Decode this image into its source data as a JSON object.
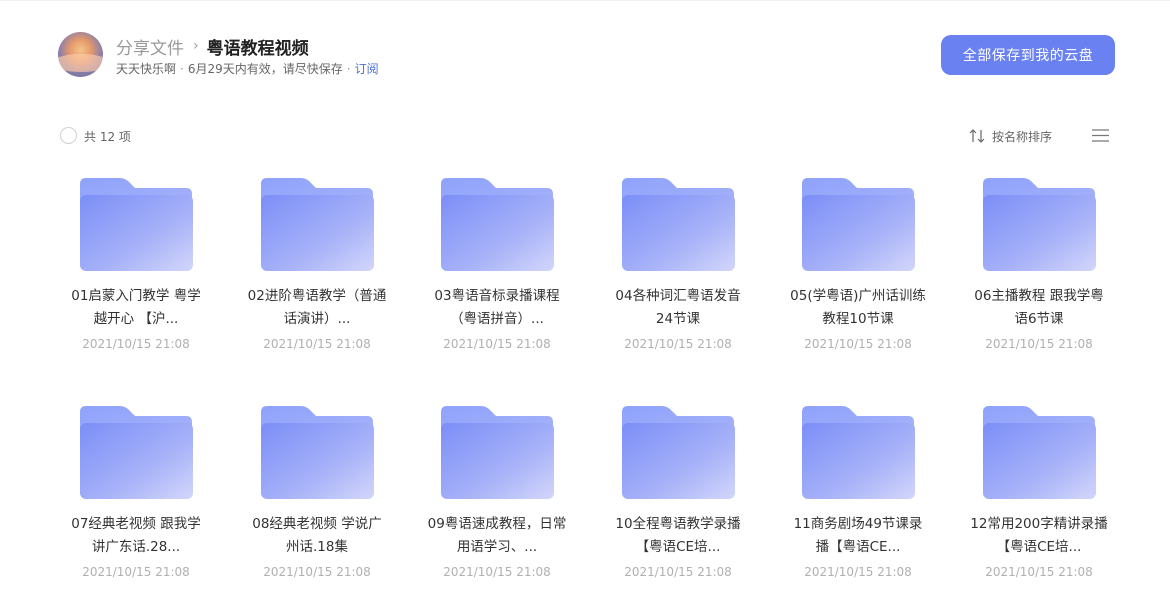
{
  "header": {
    "breadcrumb_root": "分享文件",
    "breadcrumb_sep": "›",
    "title": "粤语教程视频",
    "owner": "天天快乐啊",
    "meta_dot": "·",
    "expiry": "6月29天内有效，请尽快保存",
    "subscribe_label": "订阅"
  },
  "actions": {
    "save_all_label": "全部保存到我的云盘"
  },
  "toolbar": {
    "count_label": "共 12 项",
    "sort_label": "按名称排序"
  },
  "colors": {
    "accent": "#6a81f2",
    "link": "#4a72d8",
    "folder_light": "#b9c3fb",
    "folder_dark": "#7b8cf6"
  },
  "icons": {
    "sort": "sort-arrows-icon",
    "list": "list-view-icon",
    "folder": "folder-icon"
  },
  "files": [
    {
      "name": "01启蒙入门教学 粤学越开心 【沪...",
      "date": "2021/10/15 21:08"
    },
    {
      "name": "02进阶粤语教学（普通话演讲）...",
      "date": "2021/10/15 21:08"
    },
    {
      "name": "03粤语音标录播课程（粤语拼音）...",
      "date": "2021/10/15 21:08"
    },
    {
      "name": "04各种词汇粤语发音 24节课",
      "date": "2021/10/15 21:08"
    },
    {
      "name": "05(学粤语)广州话训练教程10节课",
      "date": "2021/10/15 21:08"
    },
    {
      "name": "06主播教程 跟我学粤语6节课",
      "date": "2021/10/15 21:08"
    },
    {
      "name": "07经典老视频 跟我学讲广东话.28...",
      "date": "2021/10/15 21:08"
    },
    {
      "name": "08经典老视频 学说广州话.18集",
      "date": "2021/10/15 21:08"
    },
    {
      "name": "09粤语速成教程，日常用语学习、...",
      "date": "2021/10/15 21:08"
    },
    {
      "name": "10全程粤语教学录播【粤语CE培...",
      "date": "2021/10/15 21:08"
    },
    {
      "name": "11商务剧场49节课录播【粤语CE...",
      "date": "2021/10/15 21:08"
    },
    {
      "name": "12常用200字精讲录播【粤语CE培...",
      "date": "2021/10/15 21:08"
    }
  ]
}
